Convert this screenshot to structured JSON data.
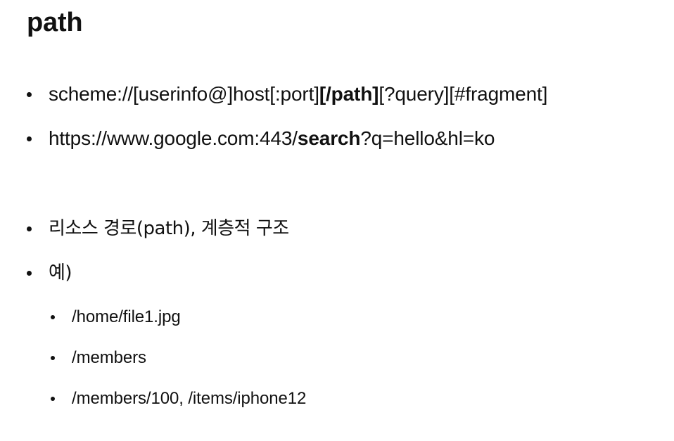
{
  "slide": {
    "top_fragment": "",
    "title": "path",
    "main_bullets": [
      {
        "parts": [
          "scheme://[userinfo@]host[:port]",
          "[/path]",
          "[?query][#fragment]"
        ]
      },
      {
        "parts": [
          "https://www.google.com:443/",
          "search",
          "?q=hello&hl=ko"
        ]
      },
      {
        "text": "리소스 경로(path), 계층적 구조"
      },
      {
        "text": "예)"
      }
    ],
    "example_bullets": [
      "/home/file1.jpg",
      "/members",
      "/members/100, /items/iphone12"
    ]
  }
}
